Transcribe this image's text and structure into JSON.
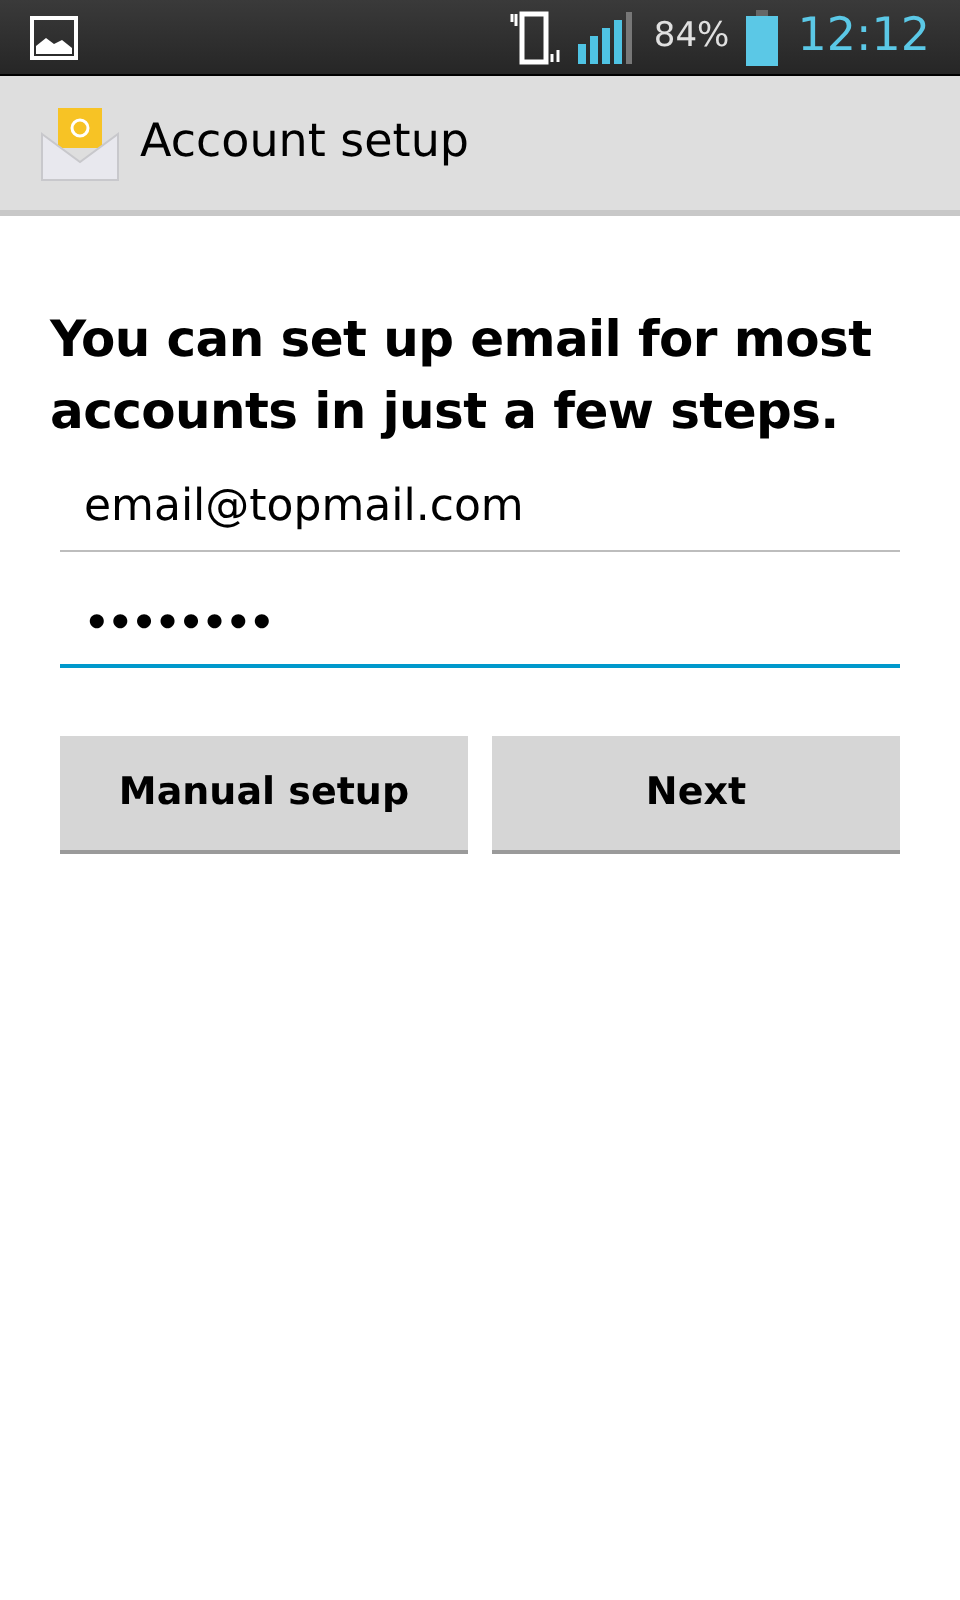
{
  "status_bar": {
    "battery": "84%",
    "time": "12:12"
  },
  "action_bar": {
    "title": "Account setup"
  },
  "heading": "You can set up email for most accounts in just a few steps.",
  "fields": [
    {
      "kind": "email",
      "value": "email@topmail.com",
      "focused": false
    },
    {
      "kind": "password",
      "value": "••••••••",
      "focused": true
    }
  ],
  "buttons": [
    {
      "label": "Manual setup"
    },
    {
      "label": "Next"
    }
  ]
}
